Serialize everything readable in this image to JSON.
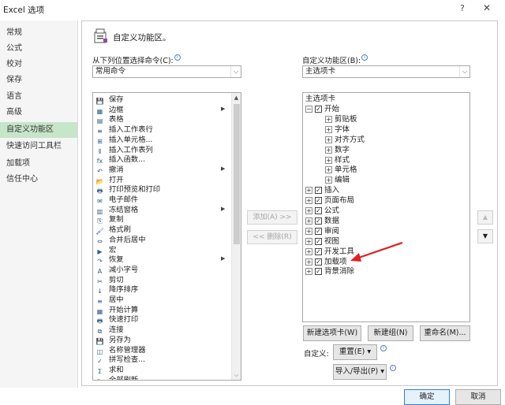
{
  "window": {
    "title": "Excel 选项",
    "help": "?",
    "close": "✕"
  },
  "nav": [
    "常规",
    "公式",
    "校对",
    "保存",
    "语言",
    "高级",
    "自定义功能区",
    "快速访问工具栏",
    "加载项",
    "信任中心"
  ],
  "header": {
    "title": "自定义功能区。"
  },
  "left_panel": {
    "label": "从下列位置选择命令(C):",
    "info": "i",
    "combo_value": "常用命令",
    "commands": [
      {
        "label": "保存",
        "icon": "💾",
        "sub": false
      },
      {
        "label": "边框",
        "icon": "▦",
        "sub": true
      },
      {
        "label": "表格",
        "icon": "▤",
        "sub": false
      },
      {
        "label": "插入工作表行",
        "icon": "≡",
        "sub": false
      },
      {
        "label": "插入单元格...",
        "icon": "⊞",
        "sub": false
      },
      {
        "label": "插入工作表列",
        "icon": "⫴",
        "sub": false
      },
      {
        "label": "插入函数...",
        "icon": "fx",
        "sub": false
      },
      {
        "label": "撤消",
        "icon": "↶",
        "sub": true
      },
      {
        "label": "打开",
        "icon": "📂",
        "sub": false
      },
      {
        "label": "打印预览和打印",
        "icon": "🖶",
        "sub": false
      },
      {
        "label": "电子邮件",
        "icon": "✉",
        "sub": false
      },
      {
        "label": "冻结窗格",
        "icon": "▥",
        "sub": true
      },
      {
        "label": "复制",
        "icon": "⎘",
        "sub": false
      },
      {
        "label": "格式刷",
        "icon": "🖌",
        "sub": false
      },
      {
        "label": "合并后居中",
        "icon": "⇔",
        "sub": false
      },
      {
        "label": "宏",
        "icon": "▶",
        "sub": false
      },
      {
        "label": "恢复",
        "icon": "↷",
        "sub": true
      },
      {
        "label": "减小字号",
        "icon": "A",
        "sub": false
      },
      {
        "label": "剪切",
        "icon": "✂",
        "sub": false
      },
      {
        "label": "降序排序",
        "icon": "↓",
        "sub": false
      },
      {
        "label": "居中",
        "icon": "≡",
        "sub": false
      },
      {
        "label": "开始计算",
        "icon": "▦",
        "sub": false
      },
      {
        "label": "快速打印",
        "icon": "🖶",
        "sub": false
      },
      {
        "label": "连接",
        "icon": "⧉",
        "sub": false
      },
      {
        "label": "另存为",
        "icon": "💾",
        "sub": false
      },
      {
        "label": "名称管理器",
        "icon": "◫",
        "sub": false
      },
      {
        "label": "拼写检查...",
        "icon": "✓",
        "sub": false
      },
      {
        "label": "求和",
        "icon": "Σ",
        "sub": false
      },
      {
        "label": "全部刷新",
        "icon": "↻",
        "sub": false
      }
    ]
  },
  "middle": {
    "add": "添加(A) >>",
    "remove": "<< 删除(R)"
  },
  "right_panel": {
    "label": "自定义功能区(B):",
    "info": "i",
    "combo_value": "主选项卡",
    "tree_header": "主选项卡",
    "tree": [
      {
        "label": "开始",
        "level": 0,
        "exp": "⊟",
        "check": true
      },
      {
        "label": "剪贴板",
        "level": 1,
        "exp": "⊞",
        "check": false
      },
      {
        "label": "字体",
        "level": 1,
        "exp": "⊞",
        "check": false
      },
      {
        "label": "对齐方式",
        "level": 1,
        "exp": "⊞",
        "check": false
      },
      {
        "label": "数字",
        "level": 1,
        "exp": "⊞",
        "check": false
      },
      {
        "label": "样式",
        "level": 1,
        "exp": "⊞",
        "check": false
      },
      {
        "label": "单元格",
        "level": 1,
        "exp": "⊞",
        "check": false
      },
      {
        "label": "编辑",
        "level": 1,
        "exp": "⊞",
        "check": false
      },
      {
        "label": "插入",
        "level": 0,
        "exp": "⊞",
        "check": true
      },
      {
        "label": "页面布局",
        "level": 0,
        "exp": "⊞",
        "check": true
      },
      {
        "label": "公式",
        "level": 0,
        "exp": "⊞",
        "check": true
      },
      {
        "label": "数据",
        "level": 0,
        "exp": "⊞",
        "check": true
      },
      {
        "label": "审阅",
        "level": 0,
        "exp": "⊞",
        "check": true
      },
      {
        "label": "视图",
        "level": 0,
        "exp": "⊞",
        "check": true
      },
      {
        "label": "开发工具",
        "level": 0,
        "exp": "⊞",
        "check": true
      },
      {
        "label": "加载项",
        "level": 0,
        "exp": "⊞",
        "check": true
      },
      {
        "label": "背景消除",
        "level": 0,
        "exp": "⊞",
        "check": true
      }
    ],
    "new_tab": "新建选项卡(W)",
    "new_group": "新建组(N)",
    "rename": "重命名(M)...",
    "customize_label": "自定义:",
    "reset": "重置(E) ▾",
    "import_export": "导入/导出(P) ▾"
  },
  "footer": {
    "ok": "确定",
    "cancel": "取消"
  },
  "colors": {
    "nav_active": "#c7e5c9",
    "annotation": "#e02020",
    "primary_border": "#2f7fd0"
  }
}
